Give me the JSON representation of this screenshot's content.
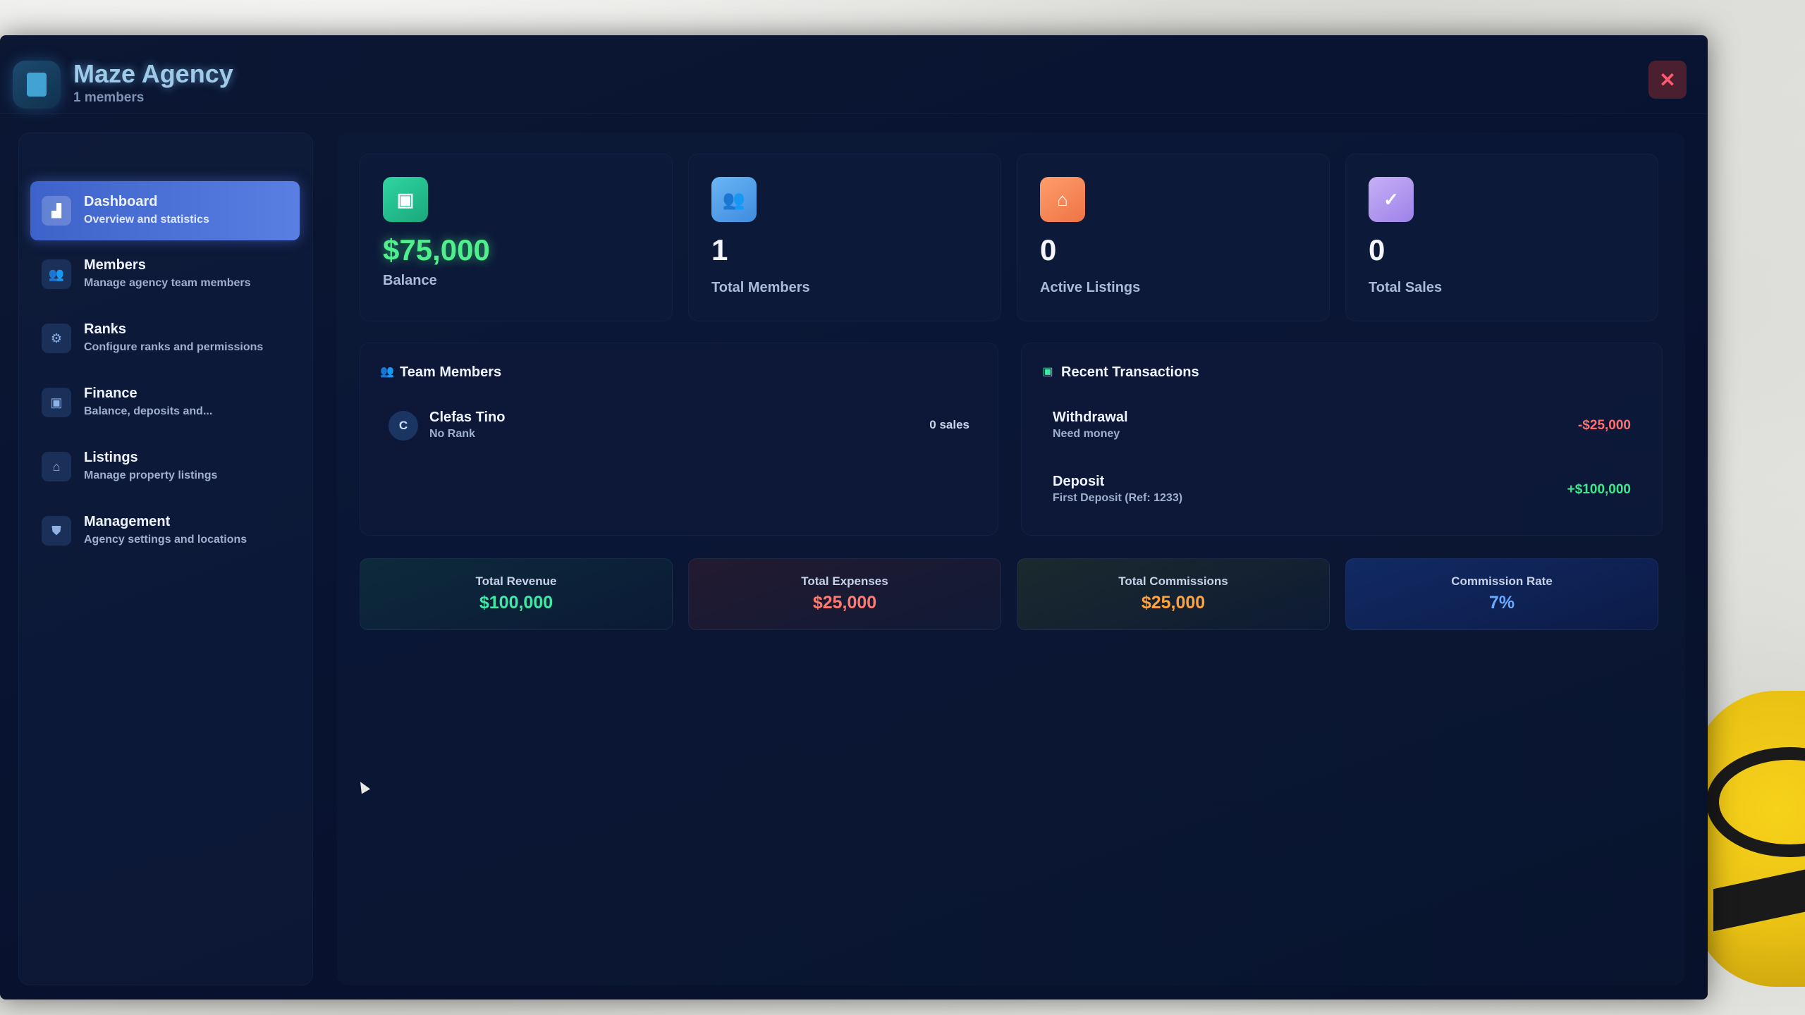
{
  "app": {
    "title": "Maze Agency",
    "subtitle": "1 members",
    "close_label": "✕"
  },
  "sidebar": {
    "items": [
      {
        "title": "Dashboard",
        "desc": "Overview and statistics",
        "icon": "chart-icon",
        "glyph": "▟",
        "active": true
      },
      {
        "title": "Members",
        "desc": "Manage agency team members",
        "icon": "users-icon",
        "glyph": "👥"
      },
      {
        "title": "Ranks",
        "desc": "Configure ranks and permissions",
        "icon": "gear-icon",
        "glyph": "⚙"
      },
      {
        "title": "Finance",
        "desc": "Balance, deposits and...",
        "icon": "wallet-icon",
        "glyph": "▣"
      },
      {
        "title": "Listings",
        "desc": "Manage property listings",
        "icon": "home-icon",
        "glyph": "⌂"
      },
      {
        "title": "Management",
        "desc": "Agency settings and locations",
        "icon": "shield-icon",
        "glyph": "⛊"
      }
    ]
  },
  "stats": [
    {
      "value": "$75,000",
      "label": "Balance",
      "icon": "wallet-icon",
      "glyph": "▣",
      "color": "#2fd6a0"
    },
    {
      "value": "1",
      "label": "Total Members",
      "icon": "users-icon",
      "glyph": "👥",
      "color": "#5aa9f0"
    },
    {
      "value": "0",
      "label": "Active Listings",
      "icon": "home-icon",
      "glyph": "⌂",
      "color": "#f48a5a"
    },
    {
      "value": "0",
      "label": "Total Sales",
      "icon": "check-circle-icon",
      "glyph": "✓",
      "color": "#b69af0"
    }
  ],
  "team_members": {
    "title": "Team Members",
    "members": [
      {
        "initial": "C",
        "name": "Clefas Tino",
        "rank": "No Rank",
        "sales": "0 sales"
      }
    ]
  },
  "transactions": {
    "title": "Recent Transactions",
    "items": [
      {
        "type": "Withdrawal",
        "note": "Need money",
        "amount": "-$25,000",
        "color": "#ff6e6e"
      },
      {
        "type": "Deposit",
        "note": "First Deposit (Ref: 1233)",
        "amount": "+$100,000",
        "color": "#3ee88a"
      }
    ]
  },
  "summary": [
    {
      "label": "Total Revenue",
      "value": "$100,000",
      "color": "#3ee8a8"
    },
    {
      "label": "Total Expenses",
      "value": "$25,000",
      "color": "#ff7a6e"
    },
    {
      "label": "Total Commissions",
      "value": "$25,000",
      "color": "#ffa23c"
    },
    {
      "label": "Commission Rate",
      "value": "7%",
      "color": "#6aa9ff"
    }
  ]
}
